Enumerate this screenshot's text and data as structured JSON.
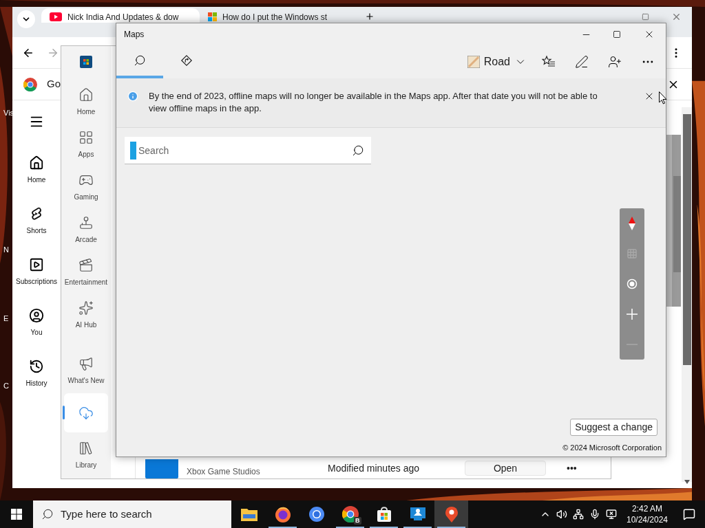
{
  "desktop": {
    "icon_labels": [
      "Vis",
      "N",
      "E",
      "C"
    ]
  },
  "browser": {
    "tabs": [
      {
        "title": "Nick India And Updates & dow",
        "selected": true,
        "kind": "youtube"
      },
      {
        "title": "How do I put the Windows st",
        "selected": false,
        "kind": "microsoft"
      }
    ],
    "bookmark_label": "Go",
    "sidebar": [
      {
        "kind": "home",
        "label": "Home"
      },
      {
        "kind": "shorts",
        "label": "Shorts"
      },
      {
        "kind": "subscriptions",
        "label": "Subscriptions"
      },
      {
        "kind": "you",
        "label": "You"
      },
      {
        "kind": "history",
        "label": "History"
      }
    ]
  },
  "store": {
    "nav": [
      {
        "kind": "home",
        "label": "Home",
        "selected": false
      },
      {
        "kind": "apps",
        "label": "Apps",
        "selected": false
      },
      {
        "kind": "gaming",
        "label": "Gaming",
        "selected": false
      },
      {
        "kind": "arcade",
        "label": "Arcade",
        "selected": false
      },
      {
        "kind": "entertainment",
        "label": "Entertainment",
        "selected": false
      },
      {
        "kind": "ai",
        "label": "AI Hub",
        "selected": false
      },
      {
        "kind": "whatsnew",
        "label": "What's New",
        "selected": false
      },
      {
        "kind": "downloads",
        "selected": true
      },
      {
        "kind": "library",
        "label": "Library",
        "selected": false
      }
    ],
    "app_row": {
      "publisher": "Xbox Game Studios",
      "status": "Modified minutes ago",
      "action": "Open",
      "more": "•••"
    }
  },
  "maps": {
    "title": "Maps",
    "tabs": [
      {
        "kind": "search",
        "selected": true
      },
      {
        "kind": "directions",
        "selected": false
      }
    ],
    "map_style": "Road",
    "notice": "By the end of 2023, offline maps will no longer be available in the Maps app. After that date you will not be able to view offline maps in the app.",
    "search": {
      "placeholder": "Search"
    },
    "controls": [
      {
        "kind": "compass",
        "disabled": false
      },
      {
        "kind": "grid",
        "disabled": true
      },
      {
        "kind": "location",
        "disabled": false
      },
      {
        "kind": "zoom_in",
        "disabled": false
      },
      {
        "kind": "zoom_out",
        "disabled": true
      }
    ],
    "suggest_button": "Suggest a change",
    "copyright": "© 2024 Microsoft Corporation"
  },
  "taskbar": {
    "search_placeholder": "Type here to search",
    "apps": [
      {
        "kind": "explorer",
        "running": false,
        "active": false
      },
      {
        "kind": "firefox",
        "running": true,
        "active": false
      },
      {
        "kind": "chromium",
        "running": false,
        "active": false
      },
      {
        "kind": "chrome",
        "badge": "B",
        "running": true,
        "active": false
      },
      {
        "kind": "store",
        "running": true,
        "active": false
      },
      {
        "kind": "remote",
        "running": true,
        "active": false
      },
      {
        "kind": "maps",
        "running": true,
        "active": true
      }
    ],
    "time": "2:42 AM",
    "date": "10/24/2024"
  }
}
